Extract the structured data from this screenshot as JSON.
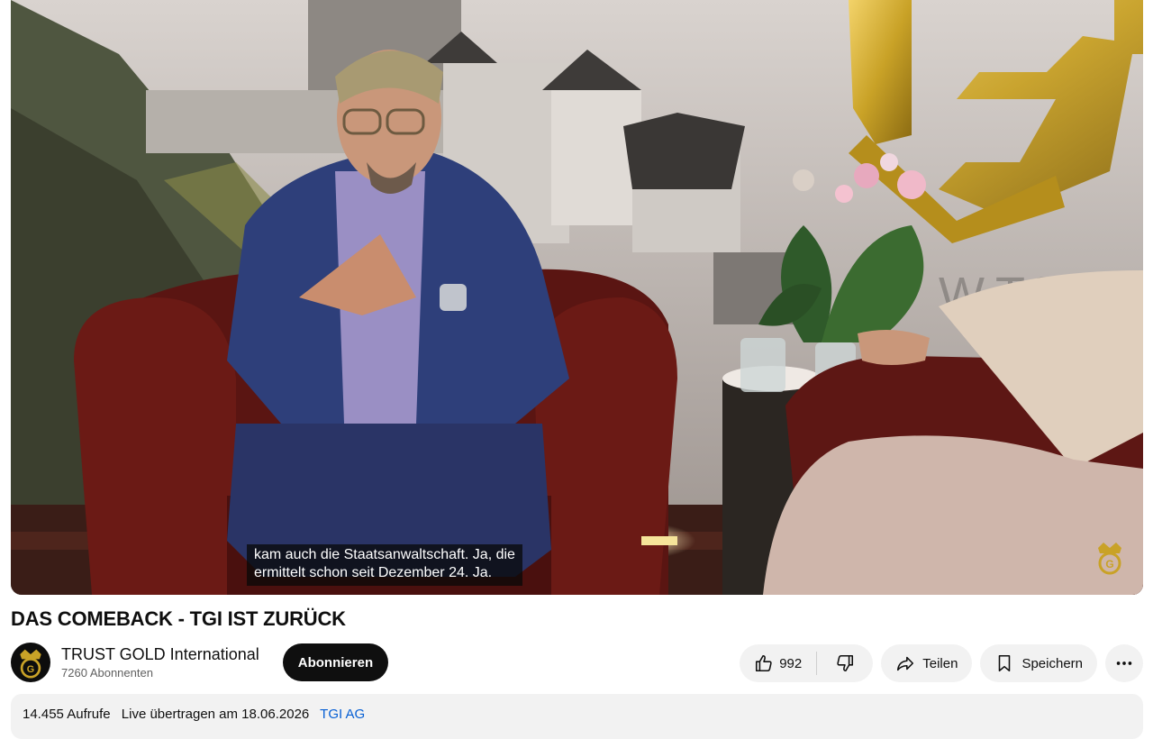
{
  "video": {
    "caption_lines": [
      "kam auch die Staatsanwaltschaft. Ja, die",
      "ermittelt schon seit Dezember 24. Ja."
    ],
    "backdrop_text": "W.TGI.L"
  },
  "title": "DAS COMEBACK - TGI IST ZURÜCK",
  "channel": {
    "name": "TRUST GOLD International",
    "subscribers": "7260 Abonnenten",
    "avatar_icon": "tgi-crown-logo-icon",
    "subscribe_label": "Abonnieren"
  },
  "actions": {
    "like_count": "992",
    "share_label": "Teilen",
    "save_label": "Speichern"
  },
  "description": {
    "views": "14.455 Aufrufe",
    "stream_info": "Live übertragen am 18.06.2026",
    "tag": "TGI AG"
  },
  "colors": {
    "gold": "#c9a227",
    "link": "#065fd4",
    "button_dark": "#0f0f0f",
    "pill_bg": "#f2f2f2"
  }
}
